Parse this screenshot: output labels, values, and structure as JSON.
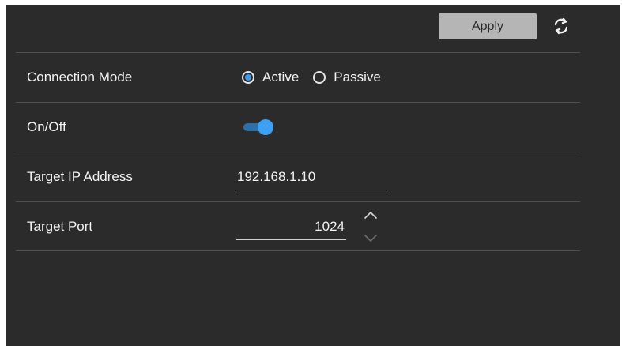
{
  "toolbar": {
    "apply_label": "Apply",
    "refresh_icon": "refresh-icon"
  },
  "settings": {
    "connection_mode": {
      "label": "Connection Mode",
      "options": [
        "Active",
        "Passive"
      ],
      "selected": "Active"
    },
    "on_off": {
      "label": "On/Off",
      "value": true
    },
    "target_ip": {
      "label": "Target IP Address",
      "value": "192.168.1.10"
    },
    "target_port": {
      "label": "Target Port",
      "value": "1024"
    }
  },
  "colors": {
    "background": "#2b2b2b",
    "accent": "#3da0f5",
    "button": "#b5b5b5",
    "divider": "#505050"
  }
}
